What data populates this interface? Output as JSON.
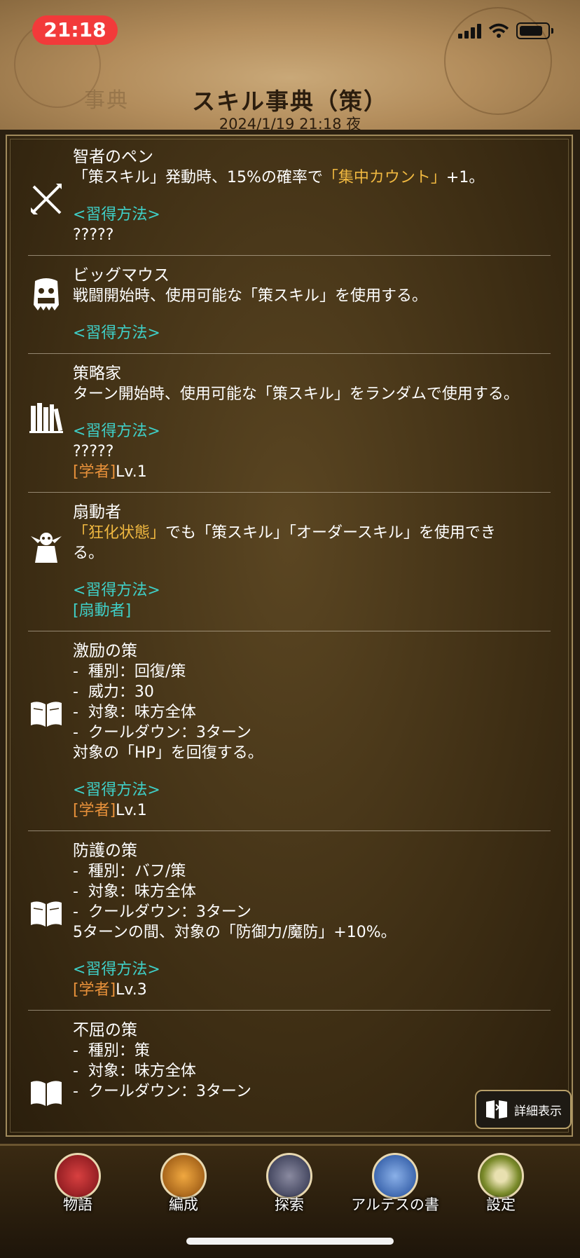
{
  "status": {
    "time": "21:18"
  },
  "header": {
    "ghost_label": "事典",
    "title": "スキル事典（策）",
    "subtitle": "2024/1/19 21:18 夜"
  },
  "entries": [
    {
      "icon": "quill-sword-icon",
      "name": "智者のペン",
      "desc_a": "「策スキル」発動時、15%の確率で",
      "desc_hl": "「集中カウント」",
      "desc_b": "+1。",
      "method_label": "<習得方法>",
      "method": "?????"
    },
    {
      "icon": "monster-mouth-icon",
      "name": "ビッグマウス",
      "desc": "戦闘開始時、使用可能な「策スキル」を使用する。",
      "method_label": "<習得方法>"
    },
    {
      "icon": "bookshelf-icon",
      "name": "策略家",
      "desc": "ターン開始時、使用可能な「策スキル」をランダムで使用する。",
      "method_label": "<習得方法>",
      "method": "?????",
      "job": "[学者]",
      "level": "Lv.1"
    },
    {
      "icon": "agitator-icon",
      "name": "扇動者",
      "desc_hl": "「狂化状態」",
      "desc_b": "でも「策スキル」「オーダースキル」を使用でき",
      "desc_c": "る。",
      "method_label": "<習得方法>",
      "method": "[扇動者]"
    },
    {
      "icon": "open-book-icon",
      "name": "激励の策",
      "stats": [
        "-  種別：回復/策",
        "-  威力：30",
        "-  対象：味方全体",
        "-  クールダウン：3ターン"
      ],
      "desc": "対象の「HP」を回復する。",
      "method_label": "<習得方法>",
      "job": "[学者]",
      "level": "Lv.1"
    },
    {
      "icon": "open-book-icon",
      "name": "防護の策",
      "stats": [
        "-  種別：バフ/策",
        "-  対象：味方全体",
        "-  クールダウン：3ターン"
      ],
      "desc": "5ターンの間、対象の「防御力/魔防」+10%。",
      "method_label": "<習得方法>",
      "job": "[学者]",
      "level": "Lv.3"
    },
    {
      "icon": "open-book-icon",
      "name": "不屈の策",
      "stats": [
        "-  種別：策",
        "-  対象：味方全体",
        "-  クールダウン：3ターン"
      ]
    }
  ],
  "detail_button": {
    "label": "詳細表示"
  },
  "nav": [
    {
      "label": "物語",
      "icon": "dragon-icon",
      "color": "#b0242a"
    },
    {
      "label": "編成",
      "icon": "phoenix-icon",
      "color": "#c27a1c"
    },
    {
      "label": "探索",
      "icon": "map-icon",
      "color": "#3a3e5a"
    },
    {
      "label": "アルテスの書",
      "icon": "scroll-icon",
      "color": "#2f5aa8"
    },
    {
      "label": "設定",
      "icon": "gear-icon",
      "color": "#6f7a2a"
    }
  ]
}
